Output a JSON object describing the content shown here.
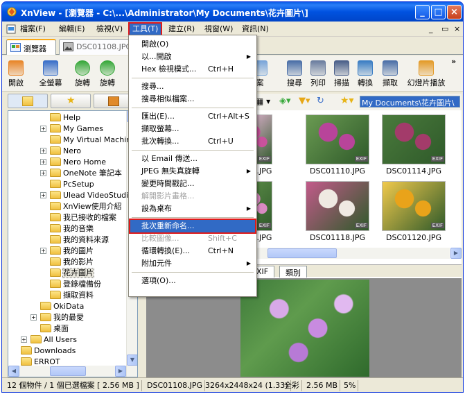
{
  "window": {
    "title": "XnView - [瀏覽器 - C:\\...\\Administrator\\My Documents\\花卉圖片\\]",
    "min": "_",
    "max": "□",
    "close": "×"
  },
  "menubar": [
    "檔案(F)",
    "編輯(E)",
    "檢視(V)",
    "工具(T)",
    "建立(R)",
    "視窗(W)",
    "資訊(N)"
  ],
  "mdi_controls": [
    "_",
    "▭",
    "×"
  ],
  "tabs": [
    {
      "label": "瀏覽器"
    },
    {
      "label": "DSC01108.JPG"
    }
  ],
  "toolbar": [
    {
      "label": "開啟",
      "color": "#e8862a"
    },
    {
      "label": "全螢幕",
      "color": "#3a6fc9"
    },
    {
      "label": "旋轉",
      "color": "#37a83a"
    },
    {
      "label": "旋轉",
      "color": "#37a83a"
    },
    {
      "label": "案",
      "color": "#7aa6d9"
    },
    {
      "label": "搜尋",
      "color": "#4b6fa8"
    },
    {
      "label": "列印",
      "color": "#6b7ea0"
    },
    {
      "label": "掃描",
      "color": "#4a5f8a"
    },
    {
      "label": "轉換",
      "color": "#3b7ec4"
    },
    {
      "label": "擷取",
      "color": "#4b6fa8"
    },
    {
      "label": "幻燈片播放",
      "color": "#e39b2a"
    }
  ],
  "toolbar_more": "»",
  "address": "My Documents\\花卉圖片\\",
  "tree": [
    {
      "label": "Help",
      "exp": ""
    },
    {
      "label": "My Games",
      "exp": "+"
    },
    {
      "label": "My Virtual Machine",
      "exp": ""
    },
    {
      "label": "Nero",
      "exp": "+"
    },
    {
      "label": "Nero Home",
      "exp": "+"
    },
    {
      "label": "OneNote 筆記本",
      "exp": "+"
    },
    {
      "label": "PcSetup",
      "exp": ""
    },
    {
      "label": "Ulead VideoStudio",
      "exp": "+"
    },
    {
      "label": "XnView使用介紹",
      "exp": ""
    },
    {
      "label": "我已接收的檔案",
      "exp": ""
    },
    {
      "label": "我的音樂",
      "exp": ""
    },
    {
      "label": "我的資料來源",
      "exp": ""
    },
    {
      "label": "我的圖片",
      "exp": "+"
    },
    {
      "label": "我的影片",
      "exp": ""
    },
    {
      "label": "花卉圖片",
      "exp": "",
      "sel": true
    },
    {
      "label": "登錄檔備份",
      "exp": ""
    },
    {
      "label": "擷取資料",
      "exp": ""
    },
    {
      "label": "OkiData",
      "exp": "",
      "lvl": 1
    },
    {
      "label": "我的最愛",
      "exp": "+",
      "lvl": 1
    },
    {
      "label": "桌面",
      "exp": "",
      "lvl": 1
    },
    {
      "label": "All Users",
      "exp": "+",
      "lvl": 0
    },
    {
      "label": "Downloads",
      "exp": "",
      "lvl": -1
    },
    {
      "label": "ERROT",
      "exp": "",
      "lvl": -1
    }
  ],
  "thumbs": [
    {
      "cap": "109.JPG",
      "c1": "#c9519c",
      "c2": "#e8b6d8"
    },
    {
      "cap": "DSC01110.JPG",
      "c1": "#b8449a",
      "c2": "#6a9a52"
    },
    {
      "cap": "DSC01114.JPG",
      "c1": "#a33b6a",
      "c2": "#4a7a3c"
    },
    {
      "cap": "117.JPG",
      "c1": "#d98ac2",
      "c2": "#5c8c48"
    },
    {
      "cap": "DSC01118.JPG",
      "c1": "#efe9e2",
      "c2": "#c25a8a"
    },
    {
      "cap": "DSC01120.JPG",
      "c1": "#e9a31a",
      "c2": "#f0c94c"
    }
  ],
  "exif": "EXIF",
  "infotabs": [
    "XIF",
    "類別"
  ],
  "status": [
    "12 個物件 / 1 個已選檔案  [ 2.56 MB ]",
    "DSC01108.JPG",
    "3264x2448x24 (1.33)",
    "全彩",
    "2.56 MB",
    "5%"
  ],
  "tools_menu": [
    {
      "label": "開啟(O)"
    },
    {
      "label": "以...開啟",
      "arrow": "▶"
    },
    {
      "label": "Hex 檢視模式...",
      "sc": "Ctrl+H"
    },
    {
      "sep": true
    },
    {
      "label": "搜尋..."
    },
    {
      "label": "搜尋相似檔案..."
    },
    {
      "sep": true
    },
    {
      "label": "匯出(E)...",
      "sc": "Ctrl+Alt+S"
    },
    {
      "label": "擷取螢幕..."
    },
    {
      "label": "批次轉換...",
      "sc": "Ctrl+U"
    },
    {
      "sep": true
    },
    {
      "label": "以 Email 傳送..."
    },
    {
      "label": "JPEG 無失真旋轉",
      "arrow": "▶"
    },
    {
      "label": "變更時間戳記..."
    },
    {
      "label": "解開影片畫格...",
      "dis": true
    },
    {
      "label": "設為桌布",
      "arrow": "▶"
    },
    {
      "sep": true
    },
    {
      "label": "批次重新命名...",
      "hl": true
    },
    {
      "label": "比較圖像...",
      "sc": "Shift+C",
      "dis": true
    },
    {
      "label": "循環轉換(E)...",
      "sc": "Ctrl+N"
    },
    {
      "label": "附加元件",
      "arrow": "▶"
    },
    {
      "sep": true
    },
    {
      "label": "選項(O)..."
    }
  ]
}
